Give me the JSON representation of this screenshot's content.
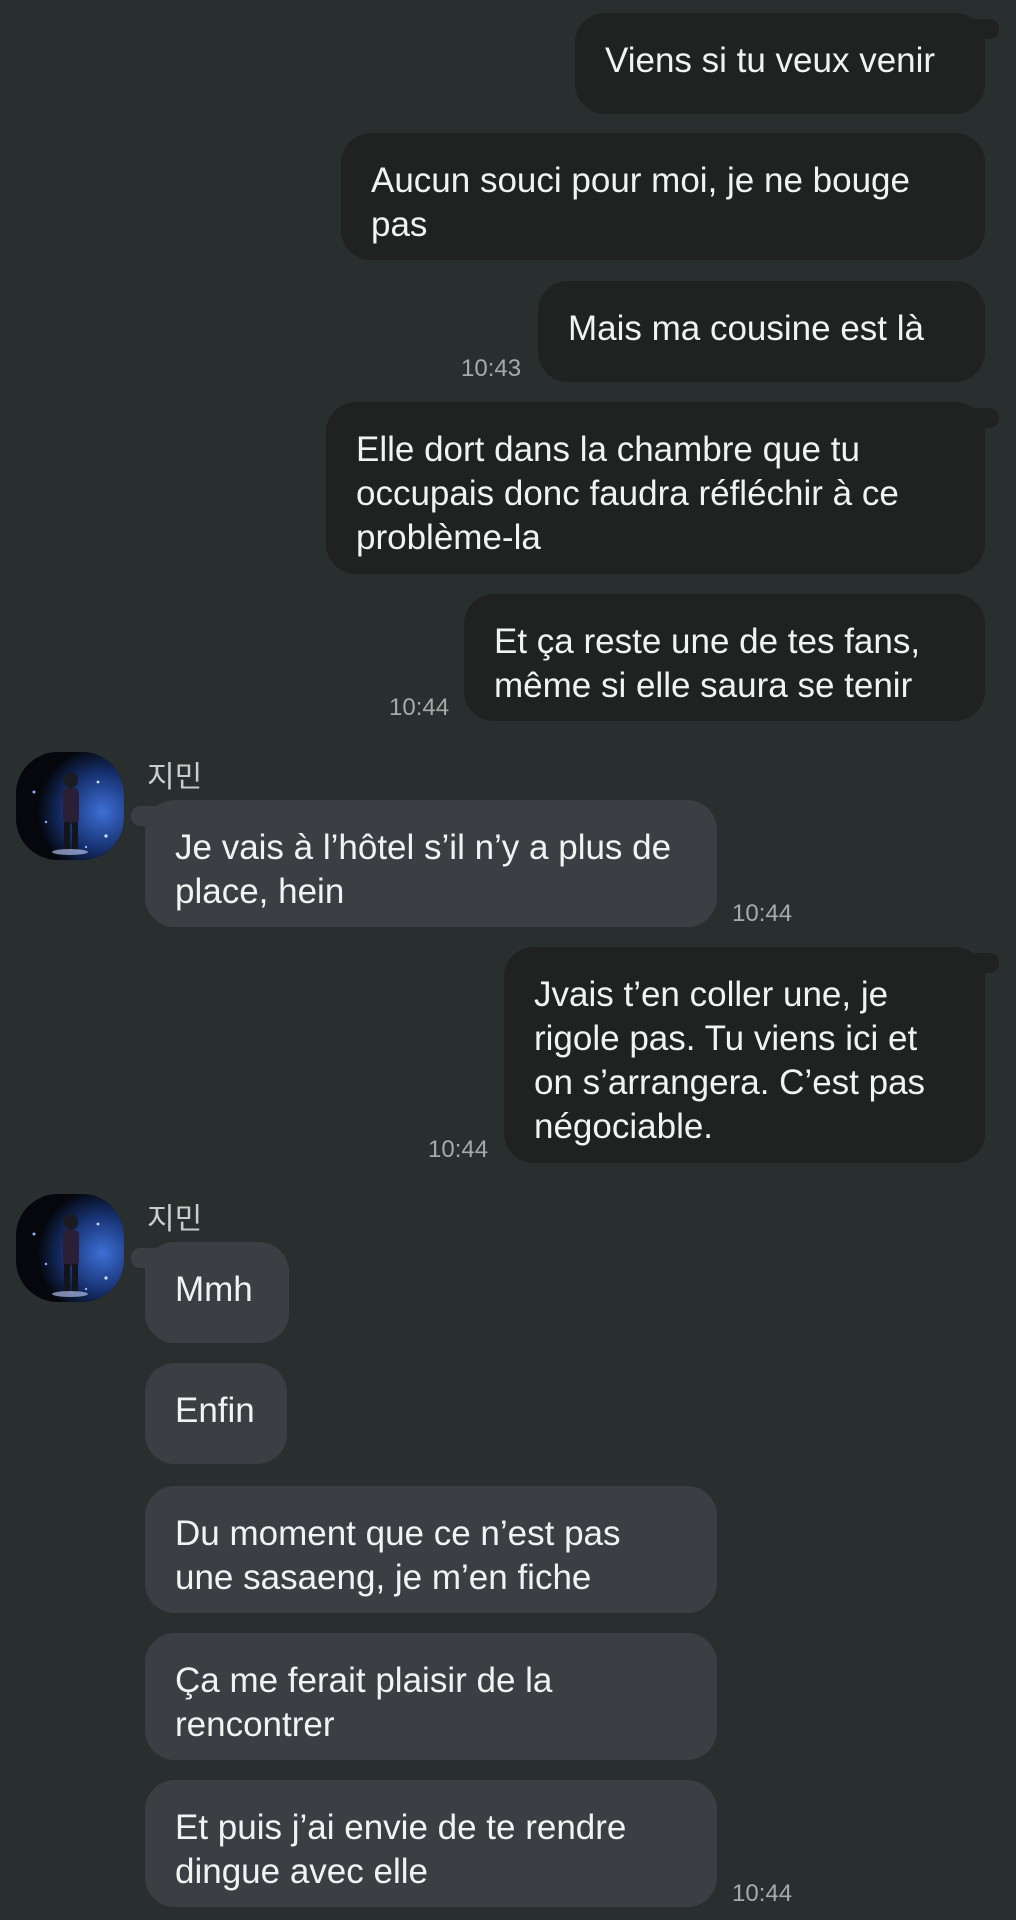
{
  "colors": {
    "background": "#292f2e",
    "sent_bubble": "#1f2221",
    "received_bubble": "#3b3f44",
    "text": "#f1f3f2",
    "timestamp": "#a6abaa"
  },
  "contact": {
    "name": "지민",
    "avatar_icon": "avatar-icon"
  },
  "messages": [
    {
      "dir": "sent",
      "text": "Viens si tu veux venir"
    },
    {
      "dir": "sent",
      "text": "Aucun souci pour moi, je ne bouge pas"
    },
    {
      "dir": "sent",
      "text": "Mais ma cousine est là",
      "time": "10:43"
    },
    {
      "dir": "sent",
      "text": "Elle dort dans la chambre que tu occupais donc faudra réfléchir à ce problème-la"
    },
    {
      "dir": "sent",
      "text": "Et ça reste une de tes fans, même si elle saura se tenir",
      "time": "10:44"
    },
    {
      "dir": "received",
      "sender": "지민",
      "text": "Je vais à l’hôtel s’il n’y a plus de place, hein",
      "time": "10:44"
    },
    {
      "dir": "sent",
      "text": "Jvais t’en coller une, je rigole pas. Tu viens ici et on s’arrangera. C’est pas négociable.",
      "time": "10:44"
    },
    {
      "dir": "received",
      "sender": "지민",
      "text": "Mmh"
    },
    {
      "dir": "received",
      "text": "Enfin"
    },
    {
      "dir": "received",
      "text": "Du moment que ce n’est pas une sasaeng, je m’en fiche"
    },
    {
      "dir": "received",
      "text": "Ça me ferait plaisir de la rencontrer"
    },
    {
      "dir": "received",
      "text": "Et puis j’ai envie de te rendre dingue avec elle",
      "time": "10:44"
    }
  ]
}
